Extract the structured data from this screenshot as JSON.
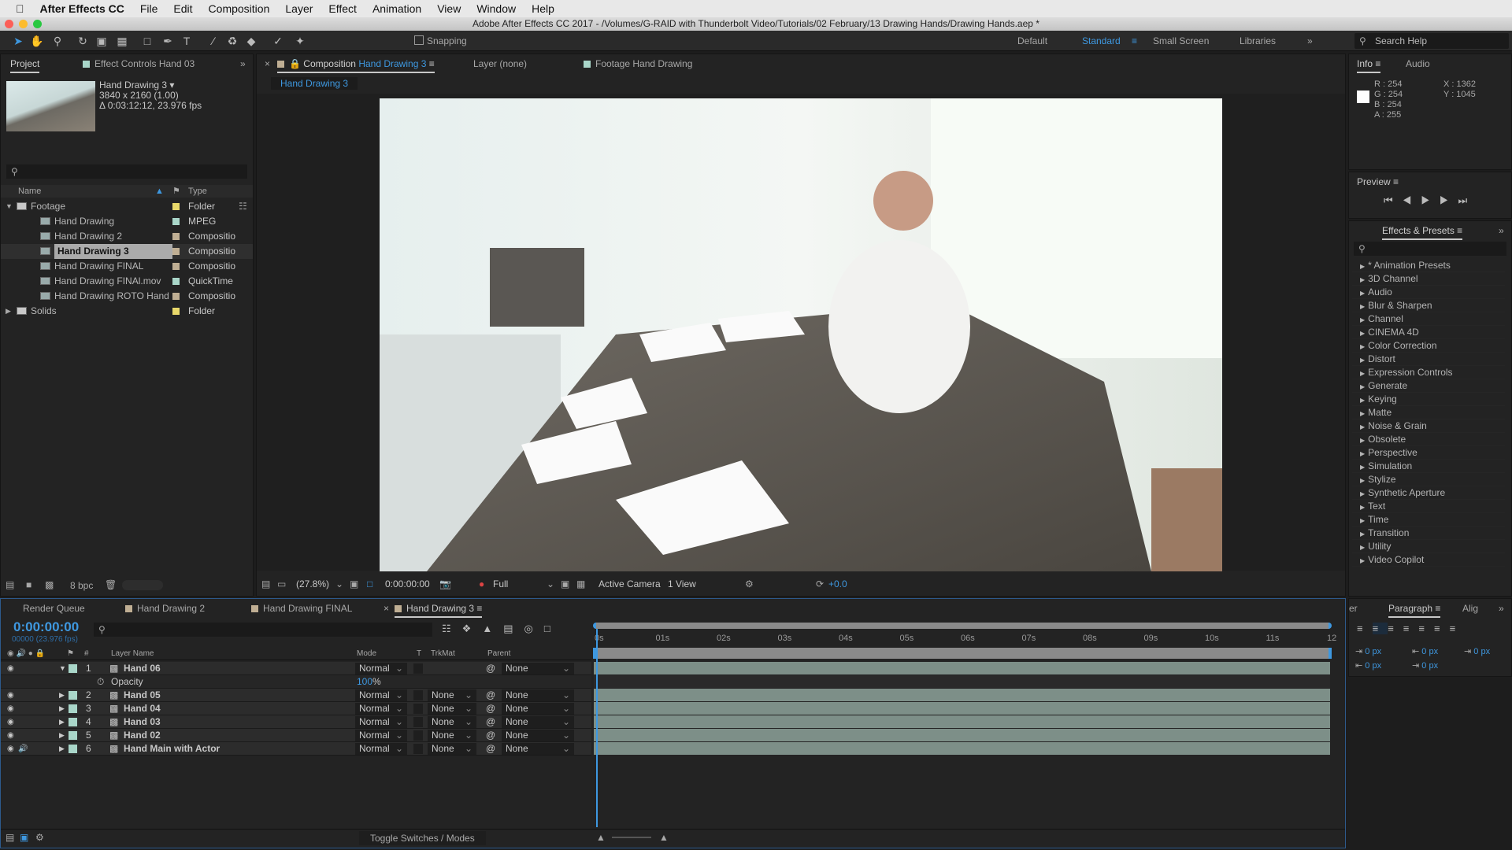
{
  "menubar": {
    "app": "After Effects CC",
    "items": [
      "File",
      "Edit",
      "Composition",
      "Layer",
      "Effect",
      "Animation",
      "View",
      "Window",
      "Help"
    ]
  },
  "titlebar": {
    "title": "Adobe After Effects CC 2017 - /Volumes/G-RAID with Thunderbolt Video/Tutorials/02 February/13 Drawing Hands/Drawing Hands.aep *"
  },
  "toolbar": {
    "snapping": "Snapping",
    "workspaces": [
      "Default",
      "Standard",
      "Small Screen",
      "Libraries"
    ],
    "active_workspace": "Standard",
    "search_help": "Search Help"
  },
  "project": {
    "tabs": [
      "Project",
      "Effect Controls Hand 03"
    ],
    "preview": {
      "name": "Hand Drawing 3 ▾",
      "size": "3840 x 2160 (1.00)",
      "duration": "Δ 0:03:12:12, 23.976 fps"
    },
    "columns": {
      "name": "Name",
      "type": "Type"
    },
    "items": [
      {
        "name": "Footage",
        "type": "Folder",
        "color": "#e8d86a",
        "kind": "folder",
        "expanded": true
      },
      {
        "name": "Hand Drawing",
        "type": "MPEG",
        "color": "#a9d6c9",
        "kind": "footage"
      },
      {
        "name": "Hand Drawing 2",
        "type": "Compositio",
        "color": "#bfae93",
        "kind": "comp"
      },
      {
        "name": "Hand Drawing 3",
        "type": "Compositio",
        "color": "#bfae93",
        "kind": "comp",
        "selected": true
      },
      {
        "name": "Hand Drawing FINAL",
        "type": "Compositio",
        "color": "#bfae93",
        "kind": "comp"
      },
      {
        "name": "Hand Drawing FINAl.mov",
        "type": "QuickTime",
        "color": "#a9d6c9",
        "kind": "footage"
      },
      {
        "name": "Hand Drawing ROTO Hand",
        "type": "Compositio",
        "color": "#bfae93",
        "kind": "comp"
      },
      {
        "name": "Solids",
        "type": "Folder",
        "color": "#e8d86a",
        "kind": "folder",
        "expanded": false
      }
    ],
    "bpc": "8 bpc"
  },
  "composition": {
    "tabs": {
      "comp_prefix": "Composition",
      "comp_name": "Hand Drawing 3",
      "layer": "Layer (none)",
      "footage": "Footage Hand Drawing"
    },
    "breadcrumb": "Hand Drawing 3",
    "viewer_bar": {
      "zoom": "(27.8%)",
      "timecode": "0:00:00:00",
      "resolution": "Full",
      "camera": "Active Camera",
      "views": "1 View",
      "exposure": "+0.0"
    }
  },
  "info": {
    "tabs": [
      "Info",
      "Audio"
    ],
    "r": "R : 254",
    "g": "G : 254",
    "b": "B : 254",
    "a": "A : 255",
    "x": "X : 1362",
    "y": "Y : 1045",
    "swatch": "#fefefe"
  },
  "preview_panel": {
    "title": "Preview"
  },
  "effects": {
    "title": "Effects & Presets",
    "items": [
      "* Animation Presets",
      "3D Channel",
      "Audio",
      "Blur & Sharpen",
      "Channel",
      "CINEMA 4D",
      "Color Correction",
      "Distort",
      "Expression Controls",
      "Generate",
      "Keying",
      "Matte",
      "Noise & Grain",
      "Obsolete",
      "Perspective",
      "Simulation",
      "Stylize",
      "Synthetic Aperture",
      "Text",
      "Time",
      "Transition",
      "Utility",
      "Video Copilot"
    ]
  },
  "paragraph": {
    "tabs": [
      "er",
      "Paragraph",
      "Alig"
    ],
    "values": [
      "0 px",
      "0 px",
      "0 px",
      "0 px",
      "0 px"
    ]
  },
  "timeline": {
    "tabs": [
      "Render Queue",
      "Hand Drawing 2",
      "Hand Drawing FINAL",
      "Hand Drawing 3"
    ],
    "timecode": "0:00:00:00",
    "frames": "00000 (23.976 fps)",
    "columns": {
      "num": "#",
      "name": "Layer Name",
      "mode": "Mode",
      "t": "T",
      "trkmat": "TrkMat",
      "parent": "Parent"
    },
    "layers": [
      {
        "num": "1",
        "name": "Hand 06",
        "mode": "Normal",
        "trkmat": "",
        "parent": "None",
        "expanded": true
      },
      {
        "num": "2",
        "name": "Hand 05",
        "mode": "Normal",
        "trkmat": "None",
        "parent": "None"
      },
      {
        "num": "3",
        "name": "Hand 04",
        "mode": "Normal",
        "trkmat": "None",
        "parent": "None"
      },
      {
        "num": "4",
        "name": "Hand 03",
        "mode": "Normal",
        "trkmat": "None",
        "parent": "None"
      },
      {
        "num": "5",
        "name": "Hand 02",
        "mode": "Normal",
        "trkmat": "None",
        "parent": "None"
      },
      {
        "num": "6",
        "name": "Hand Main with Actor",
        "mode": "Normal",
        "trkmat": "None",
        "parent": "None",
        "audio": true
      }
    ],
    "property": {
      "name": "Opacity",
      "value": "100",
      "unit": "%"
    },
    "ruler": [
      "0s",
      "01s",
      "02s",
      "03s",
      "04s",
      "05s",
      "06s",
      "07s",
      "08s",
      "09s",
      "10s",
      "11s",
      "12"
    ],
    "toggle": "Toggle Switches / Modes"
  }
}
